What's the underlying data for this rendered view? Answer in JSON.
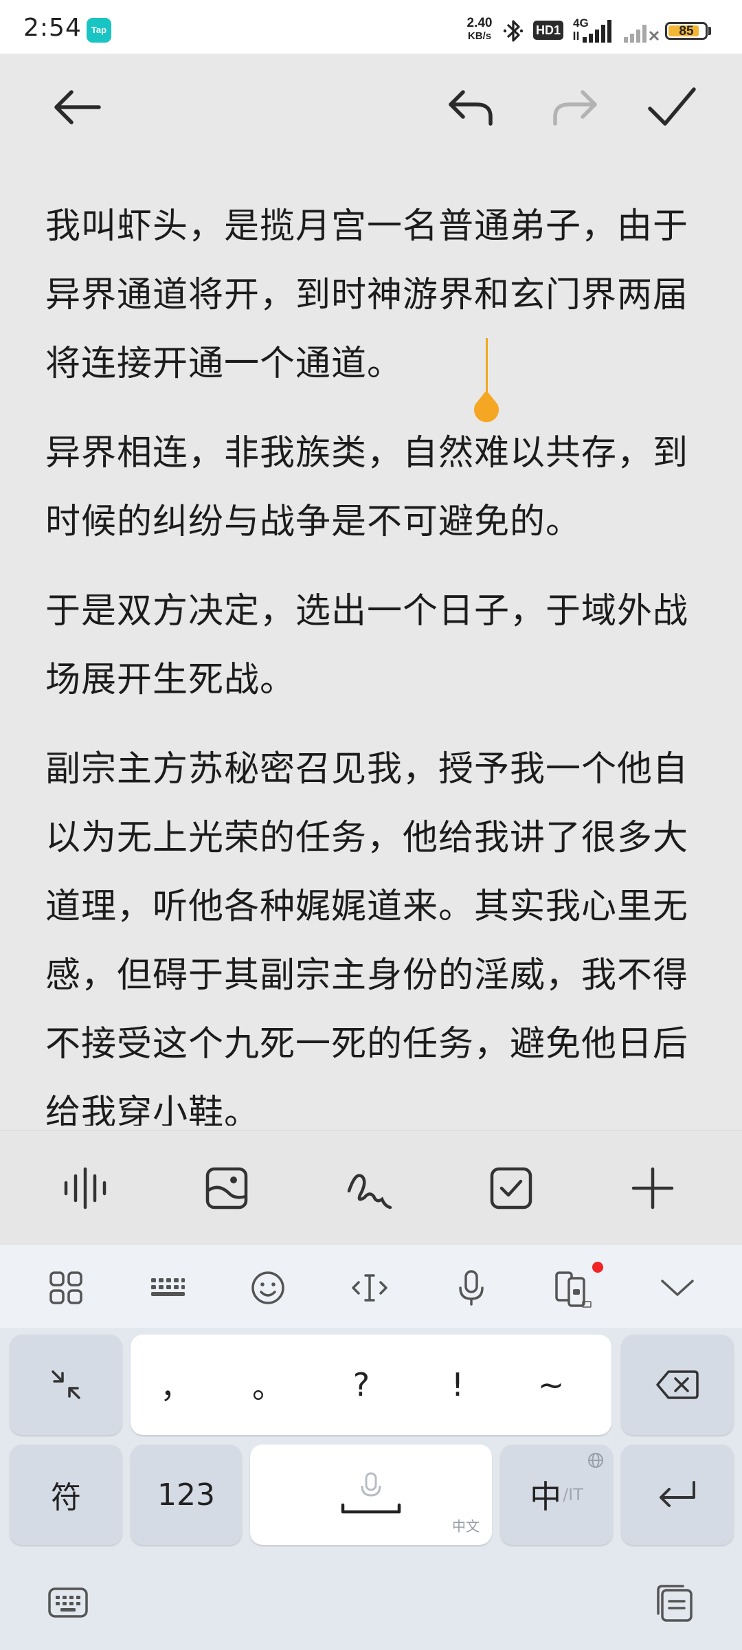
{
  "status_bar": {
    "time": "2:54",
    "app_badge": "Tap",
    "net_speed_value": "2.40",
    "net_speed_unit": "KB/s",
    "hd_badge": "HD1",
    "network_type": "4G",
    "battery_level": "85",
    "battery_fraction": 0.85,
    "battery_color": "#f2b636"
  },
  "toolbar": {
    "back_icon": "arrow-left-icon",
    "undo_icon": "undo-icon",
    "redo_icon": "redo-icon",
    "confirm_icon": "check-icon",
    "redo_disabled": true
  },
  "note": {
    "paragraphs": [
      "我叫虾头，是揽月宫一名普通弟子，由于异界通道将开，到时神游界和玄门界两届将连接开通一个通道。",
      "异界相连，非我族类，自然难以共存，到时候的纠纷与战争是不可避免的。",
      "于是双方决定，选出一个日子，于域外战场展开生死战。",
      "副宗主方苏秘密召见我，授予我一个他自以为无上光荣的任务，他给我讲了很多大道理，听他各种娓娓道来。其实我心里无感，但碍于其副宗主身份的淫威，我不得不接受这个九死一死的任务，避免他日后给我穿小鞋。"
    ],
    "caret_color": "#f0a81a"
  },
  "tools": {
    "audio_icon": "audio-wave-icon",
    "image_icon": "image-icon",
    "draw_icon": "scribble-icon",
    "checklist_icon": "checkbox-icon",
    "add_icon": "plus-icon"
  },
  "keyboard": {
    "top_icons": [
      "grid-icon",
      "keyboard-icon",
      "emoji-icon",
      "cursor-move-icon",
      "microphone-icon",
      "phone-ai-icon",
      "chevron-down-icon"
    ],
    "punctuation": [
      "，",
      "。",
      "?",
      "!",
      "~"
    ],
    "symbol_key": "符",
    "number_key": "123",
    "space_sub_label": "中文",
    "lang_key_main": "中",
    "lang_key_sub": "/IT",
    "bottom_left_icon": "keyboard-switch-icon",
    "bottom_right_icon": "clipboard-icon"
  }
}
